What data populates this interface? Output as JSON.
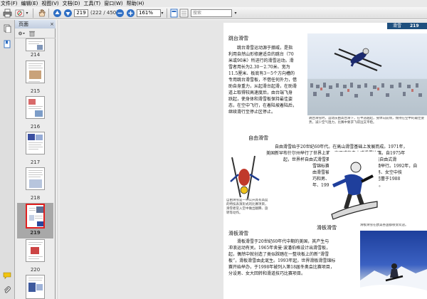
{
  "menu": [
    "文件(F)",
    "编辑(E)",
    "视图(V)",
    "文档(D)",
    "工具(T)",
    "窗口(W)",
    "帮助(H)"
  ],
  "toolbar": {
    "current_page": "219",
    "page_total": "(222 / 450)",
    "zoom": "161%",
    "search_placeholder": "搜索"
  },
  "panel": {
    "title": "页面",
    "close": "×",
    "thumbnails": [
      {
        "label": "214"
      },
      {
        "label": "215"
      },
      {
        "label": "216"
      },
      {
        "label": "217"
      },
      {
        "label": "218"
      },
      {
        "label": "219"
      },
      {
        "label": "220"
      }
    ],
    "selected_page": "219"
  },
  "page": {
    "header_title": "滑雪",
    "page_number": "219",
    "section1": {
      "title": "跳台滑雪",
      "lines": [
        "跳台滑雪运动源于挪威，是指",
        "利用自然山形修建适合的跳台（70",
        "米或90米）所进行的滑雪运动。滑",
        "雪者用长为2.30－2.70米、宽为",
        "11.5厘米、板底有3－5个方向槽的",
        "专用跳台滑雪板，不借任何外力，借",
        "助自身重力，从起滑台起滑，在助滑",
        "道上取得较高速度后，由台端飞身",
        "跃起，使身体和滑雪板保持最佳姿",
        "态，在空中飞行，在着陆坡着陆后，",
        "继续滑行至停止区停止。"
      ],
      "caption": "跳台滑雪时，运动员由高台滑下，在半途越起，身体向前倾，保持在空中的最佳姿势，减少空气阻力，比赛中要求飞得远又平稳。"
    },
    "section2": {
      "title": "自由滑雪",
      "lines": [
        "自由滑雪始于20世纪60年代。在高山滑雪基础上发展而成。1971年，",
        "美国新罕布什尔州举行了世界上第一次正式的自由式滑雪比赛。自1975年",
        "起，世界杯自由式滑雪赛开始举办。1986年，首届自由式滑",
        "雪锦标赛在法国阿尔卑斯山的蒂涅镇举行。1992年，自",
        "由滑雪被列为冬奥会比赛项目，设男、女空中技",
        "巧和男、女雪上技巧；男、女雪上芭蕾于1988",
        "年、1992年被列为冬奥会表演项目。"
      ],
      "caption": "自由滑雪是一种公开具有高度的特技表演形式的比赛项目，滑雪者常入空中做出翻腾、旋转等动作。"
    },
    "section3": {
      "title": "滑板滑雪",
      "title_right": "滑板滑雪",
      "lines": [
        "滑板滑雪于20世纪60年代中期的美国，其产生与",
        "冲浪运动有关。1965年舍曼·波潘伯格设计出滑雪板，",
        "起，偶然中就创造了类似踩踏在一整块板上的新“滑雪",
        "板”，滑板滑雪由此诞生。1993年起，世界滑板滑雪锦标",
        "赛开始举办，于1998年被列入第18届冬奥会比赛项目，",
        "分设男、女大回转和滑道技巧比赛项目。"
      ],
      "caption_mountain": "滑板滑雪在欧美各国都很受欢迎。"
    }
  },
  "colors": {
    "header_bar": "#1e4f7e",
    "selection": "#e02020",
    "toolbar_icon_blue": "#2f6fc4"
  }
}
